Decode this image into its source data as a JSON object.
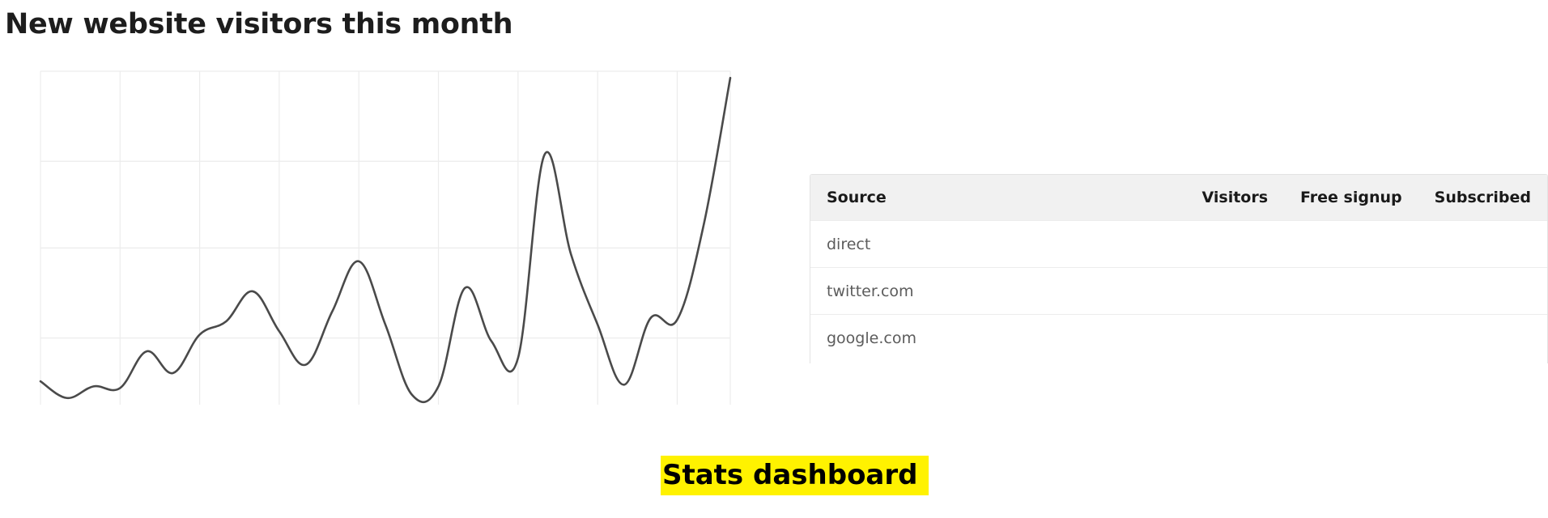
{
  "page": {
    "title": "New website visitors this month",
    "footer_label": "Stats dashboard"
  },
  "colors": {
    "line": "#4a4a4a",
    "grid": "#ececec",
    "table_header_bg": "#f1f1f1",
    "footer_highlight": "#fff200"
  },
  "chart_data": {
    "type": "line",
    "grid": true,
    "x_range": [
      0,
      26
    ],
    "y_range": [
      0,
      100
    ],
    "x_gridlines": [
      0,
      3,
      6,
      9,
      12,
      15,
      18,
      21,
      24,
      26
    ],
    "y_gridlines": [
      20,
      47,
      73,
      100
    ],
    "series": [
      {
        "values": [
          [
            0,
            7
          ],
          [
            1,
            2
          ],
          [
            2,
            5.5
          ],
          [
            3,
            5
          ],
          [
            4,
            16
          ],
          [
            5,
            9.5
          ],
          [
            6,
            21
          ],
          [
            7,
            25
          ],
          [
            8,
            34
          ],
          [
            9,
            22
          ],
          [
            10,
            12
          ],
          [
            11,
            28
          ],
          [
            12,
            43
          ],
          [
            13,
            24
          ],
          [
            14,
            3
          ],
          [
            15,
            5.5
          ],
          [
            16,
            35
          ],
          [
            17,
            19
          ],
          [
            18,
            14
          ],
          [
            19,
            75
          ],
          [
            20,
            45
          ],
          [
            21,
            24
          ],
          [
            22,
            6
          ],
          [
            23,
            26
          ],
          [
            24,
            25.5
          ],
          [
            25,
            54
          ],
          [
            26,
            98
          ]
        ]
      }
    ]
  },
  "table": {
    "headers": {
      "source": "Source",
      "visitors": "Visitors",
      "free_signup": "Free signup",
      "subscribed": "Subscribed"
    },
    "rows": [
      {
        "source": "direct",
        "visitors": "",
        "free_signup": "",
        "subscribed": ""
      },
      {
        "source": "twitter.com",
        "visitors": "",
        "free_signup": "",
        "subscribed": ""
      },
      {
        "source": "google.com",
        "visitors": "",
        "free_signup": "",
        "subscribed": ""
      }
    ]
  }
}
